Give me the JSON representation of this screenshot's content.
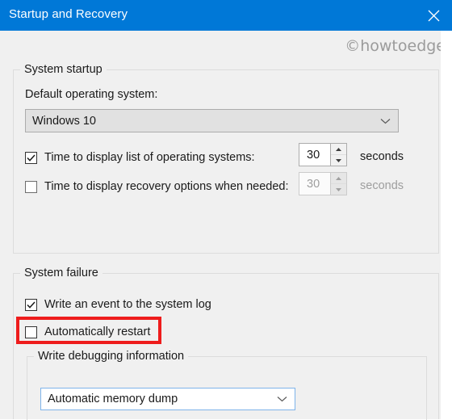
{
  "window": {
    "title": "Startup and Recovery",
    "close_icon": "close-icon",
    "titlebar_color": "#0078d7",
    "background_color": "#f0f0f0"
  },
  "watermark": {
    "text": "©howtoedge"
  },
  "system_startup": {
    "legend": "System startup",
    "default_os_label": "Default operating system:",
    "default_os_value": "Windows 10",
    "default_os_arrow_icon": "chevron-down-icon",
    "timeout_os_list": {
      "label": "Time to display list of operating systems:",
      "checked": true,
      "value": "30",
      "unit": "seconds",
      "up_icon": "spinner-up-icon",
      "down_icon": "spinner-down-icon"
    },
    "timeout_recovery": {
      "label": "Time to display recovery options when needed:",
      "checked": false,
      "value": "30",
      "unit": "seconds",
      "up_icon": "spinner-up-icon",
      "down_icon": "spinner-down-icon"
    }
  },
  "system_failure": {
    "legend": "System failure",
    "write_event": {
      "label": "Write an event to the system log",
      "checked": true
    },
    "auto_restart": {
      "label": "Automatically restart",
      "checked": false
    },
    "debug_info": {
      "legend": "Write debugging information",
      "value": "Automatic memory dump",
      "arrow_icon": "chevron-down-icon"
    }
  },
  "annotation": {
    "color": "#ee1c1c",
    "target": "Automatically restart"
  }
}
